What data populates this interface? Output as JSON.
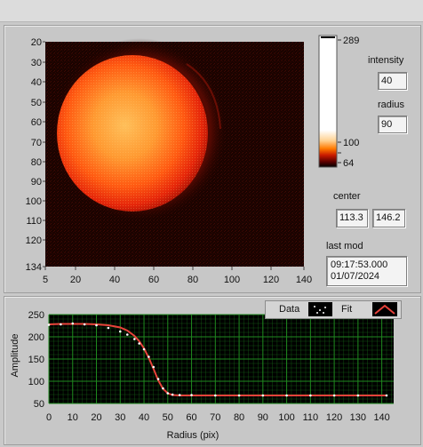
{
  "image_axes": {
    "x_ticks": [
      "5",
      "20",
      "40",
      "60",
      "80",
      "100",
      "120",
      "140"
    ],
    "y_ticks": [
      "20",
      "30",
      "40",
      "50",
      "60",
      "70",
      "80",
      "90",
      "100",
      "110",
      "120",
      "134"
    ]
  },
  "colorbar": {
    "max_label": "289",
    "mid_label": "100",
    "min_label": "64"
  },
  "controls": {
    "intensity_label": "intensity",
    "intensity_value": "40",
    "radius_label": "radius",
    "radius_value": "90",
    "center_label": "center",
    "center_x": "113.3",
    "center_y": "146.2",
    "lastmod_label": "last mod",
    "lastmod_time": "09:17:53.000",
    "lastmod_date": "01/07/2024"
  },
  "legend": {
    "data_label": "Data",
    "fit_label": "Fit"
  },
  "colors": {
    "plot_bg": "#000000",
    "grid": "#1f8a1f",
    "data": "#ffffff",
    "fit": "#e8423a"
  },
  "chart_data": {
    "type": "line",
    "xlabel": "Radius (pix)",
    "ylabel": "Amplitude",
    "xlim": [
      0,
      145
    ],
    "ylim": [
      50,
      250
    ],
    "x_ticks": [
      0,
      10,
      20,
      30,
      40,
      50,
      60,
      70,
      80,
      90,
      100,
      110,
      120,
      130,
      140
    ],
    "y_ticks": [
      50,
      100,
      150,
      200,
      250
    ],
    "grid": true,
    "legend_position": "top-right",
    "series": [
      {
        "name": "Data",
        "style": "dots",
        "x": [
          0,
          5,
          10,
          15,
          20,
          25,
          30,
          33,
          36,
          38,
          40,
          42,
          44,
          46,
          48,
          50,
          52,
          55,
          60,
          70,
          80,
          90,
          100,
          110,
          120,
          130,
          142
        ],
        "y": [
          227,
          228,
          230,
          228,
          226,
          220,
          212,
          205,
          195,
          185,
          172,
          155,
          132,
          105,
          84,
          73,
          70,
          69,
          69,
          68,
          68,
          68,
          68,
          68,
          68,
          68,
          68
        ]
      },
      {
        "name": "Fit",
        "style": "line",
        "x": [
          0,
          5,
          10,
          15,
          20,
          25,
          30,
          33,
          36,
          38,
          40,
          42,
          44,
          46,
          48,
          50,
          52,
          55,
          60,
          70,
          80,
          90,
          100,
          110,
          120,
          130,
          142
        ],
        "y": [
          228,
          229,
          229,
          229,
          228,
          226,
          221,
          214,
          202,
          190,
          174,
          153,
          128,
          102,
          83,
          73,
          69,
          68,
          68,
          68,
          68,
          68,
          68,
          68,
          68,
          68,
          68
        ]
      }
    ]
  }
}
